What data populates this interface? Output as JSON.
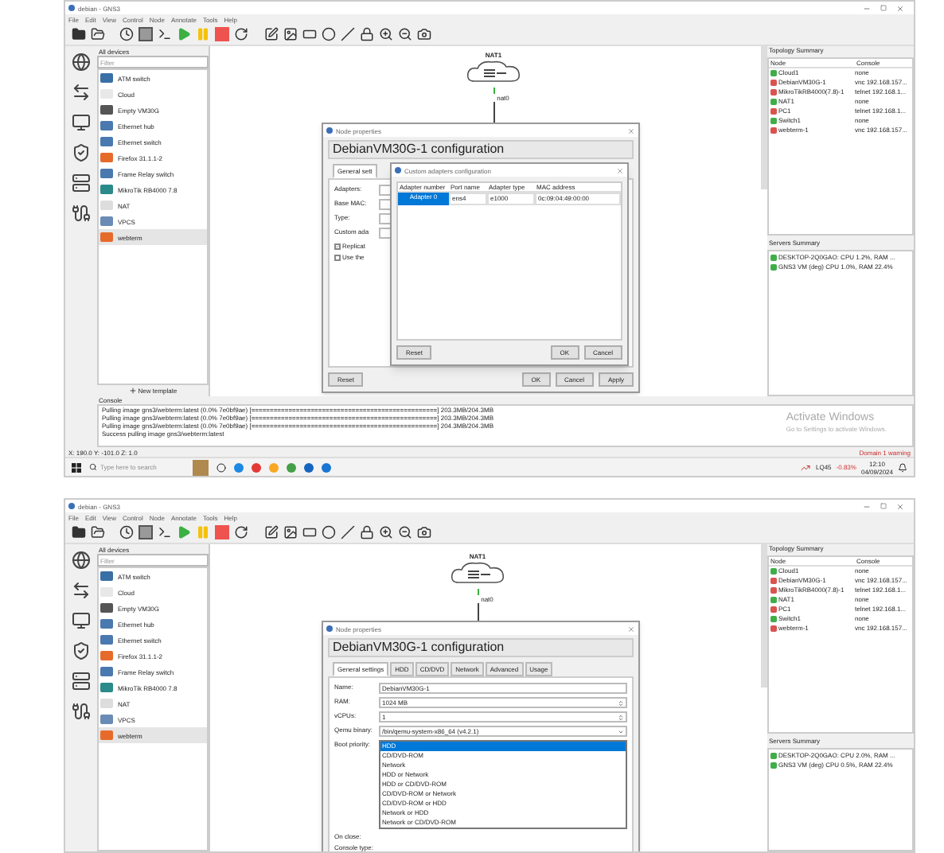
{
  "screenshots": [
    {
      "kind": "adapters",
      "window": {
        "title": "debian - GNS3"
      },
      "menu": [
        "File",
        "Edit",
        "View",
        "Control",
        "Node",
        "Annotate",
        "Tools",
        "Help"
      ],
      "devices": {
        "title": "All devices",
        "filter_placeholder": "Filter",
        "new_template": "New template",
        "items": [
          {
            "label": "ATM switch",
            "selected": false
          },
          {
            "label": "Cloud",
            "selected": false
          },
          {
            "label": "Empty VM30G",
            "selected": false
          },
          {
            "label": "Ethernet hub",
            "selected": false
          },
          {
            "label": "Ethernet switch",
            "selected": false
          },
          {
            "label": "Firefox 31.1.1-2",
            "selected": false
          },
          {
            "label": "Frame Relay switch",
            "selected": false
          },
          {
            "label": "MikroTik RB4000 7.8",
            "selected": false
          },
          {
            "label": "NAT",
            "selected": false
          },
          {
            "label": "VPCS",
            "selected": false
          },
          {
            "label": "webterm",
            "selected": true
          }
        ]
      },
      "canvas": {
        "node": "NAT1",
        "port": "nat0"
      },
      "dialog": {
        "title": "Node properties",
        "heading": "DebianVM30G-1 configuration",
        "tabs": [
          {
            "label": "General sett",
            "selected": true
          }
        ],
        "rows": [
          {
            "kind": "spin",
            "label": "Adapters:"
          },
          {
            "kind": "text",
            "label": "Base MAC:"
          },
          {
            "kind": "select",
            "label": "Type:"
          },
          {
            "kind": "text",
            "label": "Custom ada"
          },
          {
            "kind": "check",
            "label": "Replicat",
            "checked": true
          },
          {
            "kind": "check",
            "label": "Use the",
            "checked": false
          }
        ],
        "buttons": [
          "Reset",
          "OK",
          "Cancel",
          "Apply"
        ],
        "popup": {
          "title": "Custom adapters configuration",
          "columns": [
            "Adapter number",
            "Port name",
            "Adapter type",
            "MAC address"
          ],
          "rows": [
            {
              "cells": [
                "Adapter 0",
                "ens4",
                "e1000",
                "0c:09:04:49:00:00"
              ],
              "selected": true
            }
          ],
          "buttons": [
            "Reset",
            "OK",
            "Cancel"
          ]
        }
      },
      "topology": {
        "title": "Topology Summary",
        "columns": [
          "Node",
          "Console"
        ],
        "rows": [
          {
            "node": "Cloud1",
            "console": "none",
            "color": "#3fae49"
          },
          {
            "node": "DebianVM30G-1",
            "console": "vnc 192.168.157...",
            "color": "#d9534f"
          },
          {
            "node": "MikroTikRB4000(7.8)-1",
            "console": "telnet 192.168.1...",
            "color": "#d9534f"
          },
          {
            "node": "NAT1",
            "console": "none",
            "color": "#3fae49"
          },
          {
            "node": "PC1",
            "console": "telnet 192.168.1...",
            "color": "#d9534f"
          },
          {
            "node": "Switch1",
            "console": "none",
            "color": "#3fae49"
          },
          {
            "node": "webterm-1",
            "console": "vnc 192.168.157...",
            "color": "#d9534f"
          }
        ]
      },
      "servers": {
        "title": "Servers Summary",
        "rows": [
          "DESKTOP-2Q0GAO: CPU 1.2%, RAM ...",
          "GNS3 VM (deg) CPU 1.0%, RAM 22.4%"
        ]
      },
      "console": {
        "title": "Console",
        "lines": [
          "Pulling image gns3/webterm:latest (0.0% 7e0bf9ae) [==================================================] 203.3MB/204.3MB",
          "Pulling image gns3/webterm:latest (0.0% 7e0bf9ae) [==================================================] 203.3MB/204.3MB",
          "Pulling image gns3/webterm:latest (0.0% 7e0bf9ae) [==================================================] 204.3MB/204.3MB",
          "Success pulling image gns3/webterm:latest"
        ],
        "activate": [
          "Activate Windows",
          "Go to Settings to activate Windows."
        ]
      },
      "status": {
        "coords": "X: 190.0 Y: -101.0 Z: 1.0",
        "warning": "Domain 1 warning"
      },
      "taskbar": {
        "search_placeholder": "Type here to search",
        "stock": "LQ45",
        "change": "-0.83%",
        "time": "12:10",
        "date": "04/09/2024"
      }
    },
    {
      "kind": "general",
      "window": {
        "title": "debian - GNS3"
      },
      "menu": [
        "File",
        "Edit",
        "View",
        "Control",
        "Node",
        "Annotate",
        "Tools",
        "Help"
      ],
      "devices": {
        "title": "All devices",
        "filter_placeholder": "Filter",
        "items": [
          {
            "label": "ATM switch",
            "selected": false
          },
          {
            "label": "Cloud",
            "selected": false
          },
          {
            "label": "Empty VM30G",
            "selected": false
          },
          {
            "label": "Ethernet hub",
            "selected": false
          },
          {
            "label": "Ethernet switch",
            "selected": false
          },
          {
            "label": "Firefox 31.1.1-2",
            "selected": false
          },
          {
            "label": "Frame Relay switch",
            "selected": false
          },
          {
            "label": "MikroTik RB4000 7.8",
            "selected": false
          },
          {
            "label": "NAT",
            "selected": false
          },
          {
            "label": "VPCS",
            "selected": false
          },
          {
            "label": "webterm",
            "selected": true
          }
        ]
      },
      "canvas": {
        "node": "NAT1",
        "port": "nat0"
      },
      "dialog": {
        "title": "Node properties",
        "heading": "DebianVM30G-1 configuration",
        "tabs": [
          {
            "label": "General settings",
            "selected": true
          },
          {
            "label": "HDD",
            "selected": false
          },
          {
            "label": "CD/DVD",
            "selected": false
          },
          {
            "label": "Network",
            "selected": false
          },
          {
            "label": "Advanced",
            "selected": false
          },
          {
            "label": "Usage",
            "selected": false
          }
        ],
        "rows": [
          {
            "kind": "text",
            "label": "Name:",
            "value": "DebianVM30G-1"
          },
          {
            "kind": "spin",
            "label": "RAM:",
            "value": "1024 MB"
          },
          {
            "kind": "spin",
            "label": "vCPUs:",
            "value": "1"
          },
          {
            "kind": "select",
            "label": "Qemu binary:",
            "value": "/bin/qemu-system-x86_64 (v4.2.1)"
          },
          {
            "kind": "list",
            "label": "Boot priority:",
            "options": [
              {
                "label": "HDD",
                "selected": true
              },
              {
                "label": "CD/DVD-ROM",
                "selected": false
              },
              {
                "label": "Network",
                "selected": false
              },
              {
                "label": "HDD or Network",
                "selected": false
              },
              {
                "label": "HDD or CD/DVD-ROM",
                "selected": false
              },
              {
                "label": "CD/DVD-ROM or Network",
                "selected": false
              },
              {
                "label": "CD/DVD-ROM or HDD",
                "selected": false
              },
              {
                "label": "Network or HDD",
                "selected": false
              },
              {
                "label": "Network or CD/DVD-ROM",
                "selected": false
              }
            ]
          },
          {
            "kind": "label",
            "label": "On close:"
          },
          {
            "kind": "label",
            "label": "Console type:"
          }
        ]
      },
      "topology": {
        "title": "Topology Summary",
        "columns": [
          "Node",
          "Console"
        ],
        "rows": [
          {
            "node": "Cloud1",
            "console": "none",
            "color": "#3fae49"
          },
          {
            "node": "DebianVM30G-1",
            "console": "vnc 192.168.157...",
            "color": "#d9534f"
          },
          {
            "node": "MikroTikRB4000(7.8)-1",
            "console": "telnet 192.168.1...",
            "color": "#d9534f"
          },
          {
            "node": "NAT1",
            "console": "none",
            "color": "#3fae49"
          },
          {
            "node": "PC1",
            "console": "telnet 192.168.1...",
            "color": "#d9534f"
          },
          {
            "node": "Switch1",
            "console": "none",
            "color": "#3fae49"
          },
          {
            "node": "webterm-1",
            "console": "vnc 192.168.157...",
            "color": "#d9534f"
          }
        ]
      },
      "servers": {
        "title": "Servers Summary",
        "rows": [
          "DESKTOP-2Q0GAO: CPU 2.0%, RAM ...",
          "GNS3 VM (deg) CPU 0.5%, RAM 22.4%"
        ]
      }
    }
  ]
}
